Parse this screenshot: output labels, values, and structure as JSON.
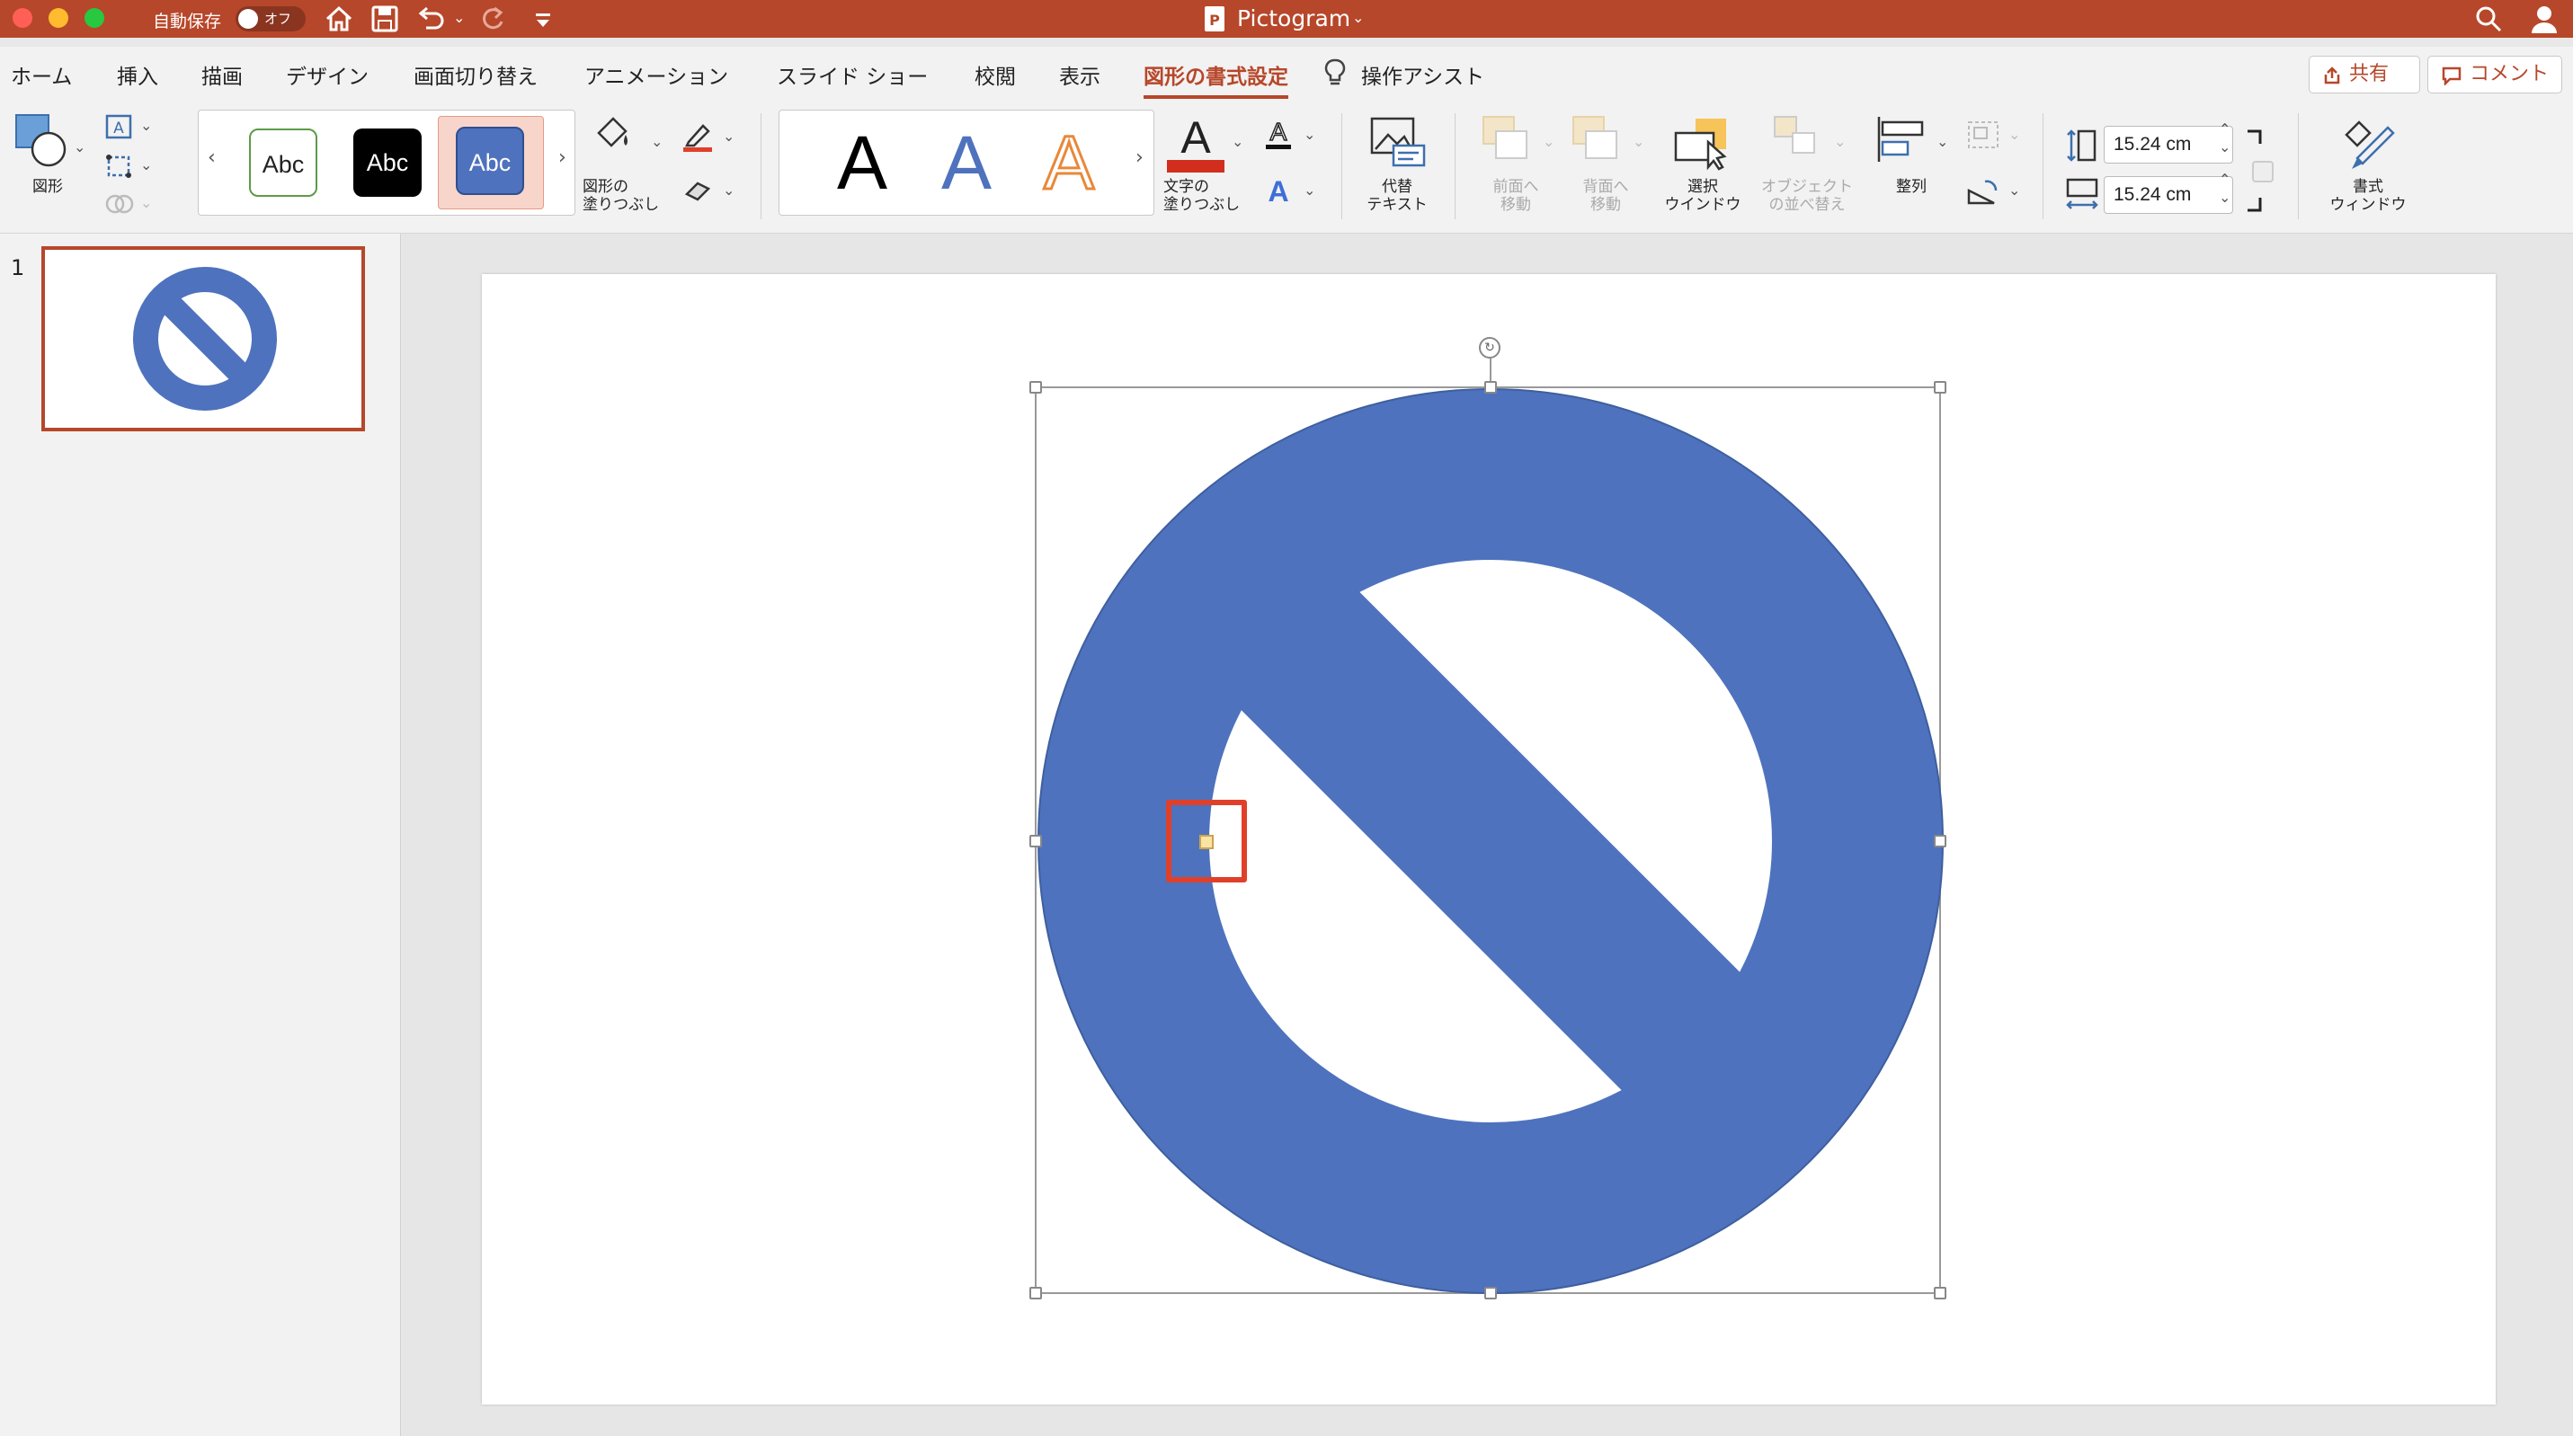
{
  "titlebar": {
    "autosave_label": "自動保存",
    "autosave_state": "オフ",
    "doc_title": "Pictogram"
  },
  "menu": {
    "tabs": [
      "ホーム",
      "挿入",
      "描画",
      "デザイン",
      "画面切り替え",
      "アニメーション",
      "スライド ショー",
      "校閲",
      "表示",
      "図形の書式設定"
    ],
    "active_tab": "図形の書式設定",
    "assist": "操作アシスト",
    "share": "共有",
    "comment": "コメント"
  },
  "ribbon": {
    "shapes_label": "図形",
    "style_samples": [
      "Abc",
      "Abc",
      "Abc"
    ],
    "shape_fill_label": [
      "図形の",
      "塗りつぶし"
    ],
    "wordart_samples": [
      "A",
      "A",
      "A"
    ],
    "text_fill_label": [
      "文字の",
      "塗りつぶし"
    ],
    "alt_text_label": [
      "代替",
      "テキスト"
    ],
    "bring_forward_label": [
      "前面へ",
      "移動"
    ],
    "send_backward_label": [
      "背面へ",
      "移動"
    ],
    "selection_pane_label": [
      "選択",
      "ウインドウ"
    ],
    "arrange_objects_label": [
      "オブジェクト",
      "の並べ替え"
    ],
    "align_label": "整列",
    "height_value": "15.24 cm",
    "width_value": "15.24 cm",
    "format_pane_label": [
      "書式",
      "ウィンドウ"
    ]
  },
  "slides_pane": {
    "slide_number": "1"
  },
  "colors": {
    "accent": "#b7472a",
    "shape_fill": "#4e72bd",
    "highlight": "#e0402a"
  },
  "icons": [
    "home-icon",
    "save-icon",
    "undo-icon",
    "redo-icon",
    "customize-icon",
    "search-icon",
    "person-icon",
    "lightbulb-icon",
    "share-icon",
    "comment-icon"
  ]
}
